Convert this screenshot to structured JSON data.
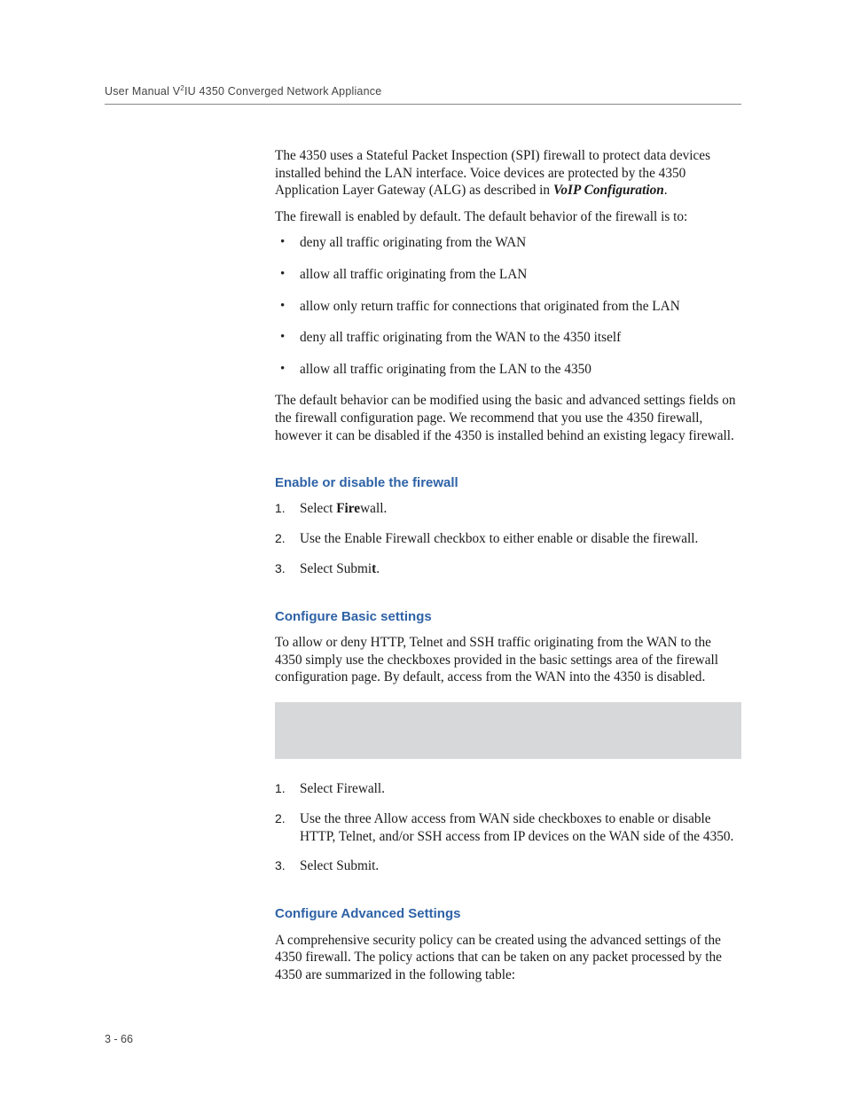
{
  "header": {
    "prefix": "User Manual V",
    "sup": "2",
    "suffix": "IU 4350 Converged Network Appliance"
  },
  "intro": {
    "p1_a": "The 4350 uses a Stateful Packet Inspection (SPI) firewall to protect data devices installed behind the LAN interface. Voice devices are protected by the 4350 Application Layer Gateway (ALG) as described in ",
    "p1_b": "VoIP Configuration",
    "p1_c": ".",
    "p2": "The firewall is enabled by default. The default behavior of the firewall is to:"
  },
  "bullets": [
    "deny all traffic originating from the WAN",
    "allow all traffic originating from the LAN",
    "allow only return traffic for connections that originated from the LAN",
    "deny all traffic originating from the WAN to the 4350 itself",
    "allow all traffic originating from the LAN to the 4350"
  ],
  "post_bullets": "The default behavior can be modified using the basic and advanced settings fields on the firewall configuration page. We recommend that you use the 4350 firewall, however it can be disabled if the 4350 is installed behind an existing legacy firewall.",
  "section1": {
    "title": "Enable or disable the firewall",
    "steps": {
      "s1_a": "Select ",
      "s1_b": "Fire",
      "s1_c": "wall.",
      "s2": "Use the Enable Firewall checkbox to either enable or disable the firewall.",
      "s3_a": "Select Submi",
      "s3_b": "t",
      "s3_c": "."
    }
  },
  "section2": {
    "title": "Configure Basic settings",
    "p": "To allow or deny HTTP, Telnet and SSH traffic originating from the WAN to the 4350 simply use the checkboxes provided in the basic settings area of the firewall configuration page. By default, access from the WAN into the 4350 is disabled.",
    "steps": {
      "s1": "Select Firewall.",
      "s2": "Use the three Allow access from WAN side checkboxes to enable or disable HTTP, Telnet, and/or SSH access from IP devices on the WAN side of the 4350.",
      "s3": "Select Submit."
    }
  },
  "section3": {
    "title": "Configure Advanced Settings",
    "p": "A comprehensive security policy can be created using the advanced settings of the 4350 firewall. The policy actions that can be taken on any packet processed by the 4350 are summarized in the following table:"
  },
  "footer": "3 - 66",
  "nums": {
    "n1": "1.",
    "n2": "2.",
    "n3": "3."
  }
}
